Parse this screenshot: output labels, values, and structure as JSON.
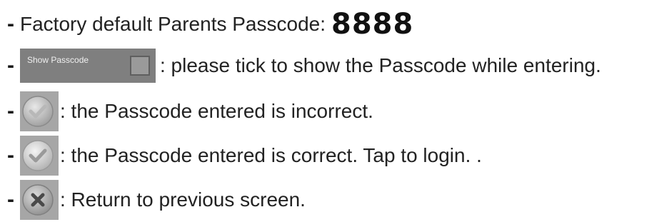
{
  "lines": [
    {
      "dash": "-",
      "text": "Factory default Parents Passcode:",
      "passcode": "8888"
    },
    {
      "dash": "-",
      "widget_label": "Show Passcode",
      "text": ": please tick to show the Passcode while entering."
    },
    {
      "dash": "-",
      "icon": "check-disabled-icon",
      "text": ": the Passcode entered is incorrect."
    },
    {
      "dash": "-",
      "icon": "check-enabled-icon",
      "text": ": the Passcode entered is correct. Tap to login. ."
    },
    {
      "dash": "-",
      "icon": "close-icon",
      "text": ": Return to previous screen."
    }
  ],
  "colors": {
    "widget_bg": "#7f7f7f",
    "icon_bg": "#a6a6a6",
    "text": "#222222"
  }
}
